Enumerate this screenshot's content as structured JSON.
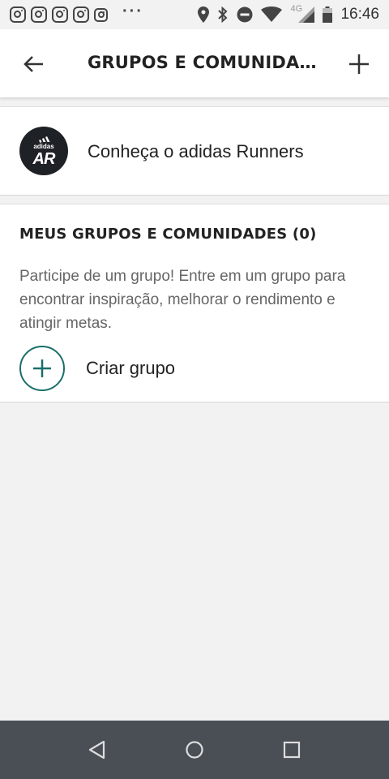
{
  "status_bar": {
    "time": "16:46",
    "network_label": "4G",
    "notification_icons": [
      "instagram-icon",
      "instagram-icon",
      "instagram-icon",
      "instagram-icon",
      "instagram-icon"
    ],
    "more_icon": "ellipsis-icon",
    "system_icons": [
      "location-icon",
      "bluetooth-icon",
      "do-not-disturb-icon",
      "wifi-icon",
      "signal-icon",
      "battery-icon"
    ]
  },
  "app_bar": {
    "title": "GRUPOS E COMUNIDADES",
    "back_icon": "arrow-left-icon",
    "add_icon": "plus-icon"
  },
  "adidas_card": {
    "logo_text": "adidas",
    "logo_monogram": "AR",
    "label": "Conheça o adidas Runners"
  },
  "my_groups": {
    "title": "MEUS GRUPOS E COMUNIDADES (0)",
    "description": "Participe de um grupo! Entre em um grupo para encontrar inspiração, melhorar o rendimento e atingir metas.",
    "create_label": "Criar grupo"
  },
  "nav_bar": {
    "buttons": [
      "back-triangle-icon",
      "home-circle-icon",
      "recents-square-icon"
    ]
  },
  "colors": {
    "accent": "#1a6f6a",
    "background": "#f2f2f2",
    "card": "#ffffff",
    "nav_bar": "#4a4f56"
  }
}
